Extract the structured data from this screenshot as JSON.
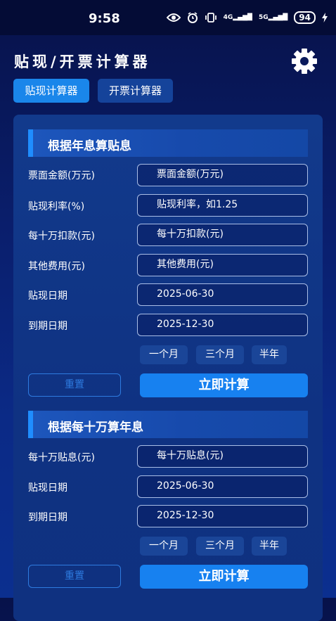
{
  "status": {
    "time": "9:58",
    "battery": "94",
    "network_a": "4G",
    "network_b": "5G"
  },
  "header": {
    "title": "贴现/开票计算器",
    "tabs": [
      {
        "label": "贴现计算器",
        "active": true
      },
      {
        "label": "开票计算器",
        "active": false
      }
    ]
  },
  "section1": {
    "title": "根据年息算贴息",
    "rows": [
      {
        "label": "票面金额(万元)",
        "value": "票面金额(万元)"
      },
      {
        "label": "贴现利率(%)",
        "value": "贴现利率，如1.25"
      },
      {
        "label": "每十万扣款(元)",
        "value": "每十万扣款(元)"
      },
      {
        "label": "其他费用(元)",
        "value": "其他费用(元)"
      },
      {
        "label": "贴现日期",
        "value": "2025-06-30"
      },
      {
        "label": "到期日期",
        "value": "2025-12-30"
      }
    ],
    "chips": [
      "一个月",
      "三个月",
      "半年"
    ],
    "reset": "重置",
    "calc": "立即计算"
  },
  "section2": {
    "title": "根据每十万算年息",
    "rows": [
      {
        "label": "每十万贴息(元)",
        "value": "每十万贴息(元)"
      },
      {
        "label": "贴现日期",
        "value": "2025-06-30"
      },
      {
        "label": "到期日期",
        "value": "2025-12-30"
      }
    ],
    "chips": [
      "一个月",
      "三个月",
      "半年"
    ],
    "reset": "重置",
    "calc": "立即计算"
  },
  "colors": {
    "accent": "#1781f0",
    "tab_active": "#1a86ea",
    "background": "#0a1f6e"
  }
}
